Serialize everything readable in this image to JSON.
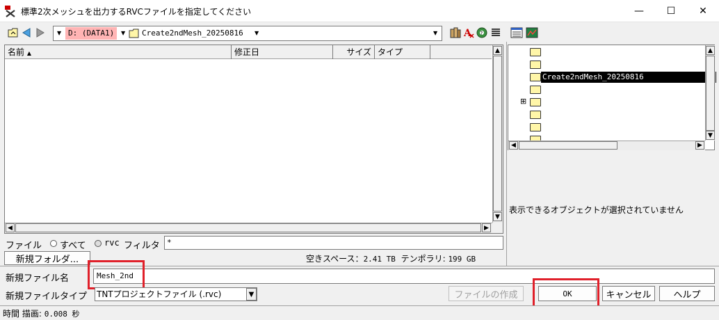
{
  "window": {
    "title": "標準2次メッシュを出力するRVCファイルを指定してください",
    "minimize": "—",
    "maximize": "☐",
    "close": "✕"
  },
  "toolbar": {
    "drive": "D: (DATA1)",
    "folder": "Create2ndMesh_20250816"
  },
  "filelist": {
    "columns": [
      "名前",
      "修正日",
      "サイズ",
      "タイプ"
    ],
    "sort_indicator": "▲"
  },
  "filter": {
    "file_label": "ファイル",
    "all_label": "すべて",
    "rvc_label": "rvc",
    "filter_label": "フィルタ",
    "pattern": "*"
  },
  "new_folder_button": "新規フォルダ...",
  "space": {
    "free_label": "空きスペース：",
    "free_value": "2.41 TB",
    "temp_label": "テンポラリ:",
    "temp_value": "199 GB"
  },
  "tree": {
    "selected": "Create2ndMesh_20250816",
    "expand": "⊞"
  },
  "status_message": "表示できるオブジェクトが選択されていません",
  "new_file": {
    "label": "新規ファイル名",
    "value": "Mesh_2nd"
  },
  "file_type": {
    "label": "新規ファイルタイプ",
    "value": "TNTプロジェクトファイル (.rvc)"
  },
  "buttons": {
    "create": "ファイルの作成",
    "ok": "OK",
    "cancel": "キャンセル",
    "help": "ヘルプ"
  },
  "statusbar": {
    "time_label": "時間",
    "draw_label": "描画:",
    "draw_value": "0.008 秒"
  },
  "colors": {
    "highlight_box": "#e0202a",
    "drive_bg": "#ffb4b4",
    "tree_selected_bg": "#000000"
  }
}
